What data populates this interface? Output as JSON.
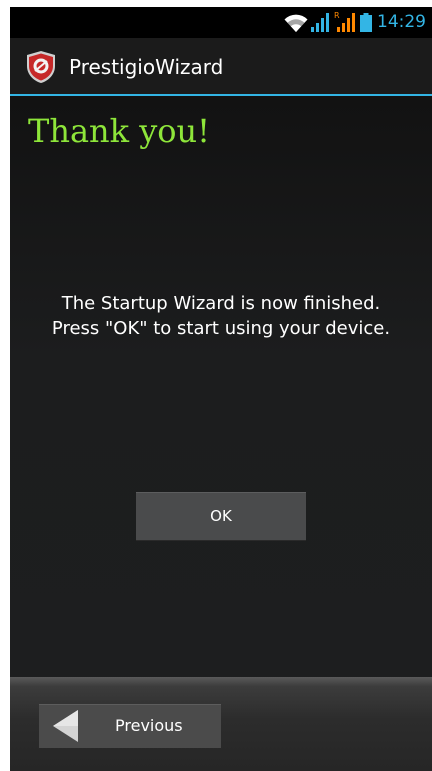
{
  "status_bar": {
    "time": "14:29",
    "icons": [
      "wifi-icon",
      "signal-icon",
      "roaming-signal-icon",
      "battery-icon"
    ],
    "accent_color": "#33b5e5"
  },
  "action_bar": {
    "title": "PrestigioWizard",
    "logo_icon": "prestigio-shield-icon",
    "divider_color": "#33b5e5"
  },
  "main": {
    "heading": "Thank you!",
    "heading_color": "#8ee63a",
    "message": "The Startup Wizard is now finished.\nPress \"OK\" to start using your device.",
    "ok_label": "OK"
  },
  "bottom_bar": {
    "previous_label": "Previous",
    "previous_icon": "back-arrow-icon"
  }
}
